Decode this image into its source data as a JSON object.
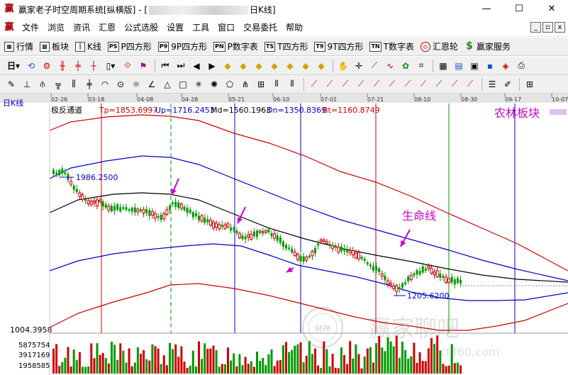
{
  "window": {
    "app_name": "赢家老子时空周期系统[纵横版]",
    "title_prefix": "赢家老子时空周期系统[纵横版] - [",
    "title_suffix": "日K线]",
    "minimize": "—",
    "maximize": "☐",
    "close": "✕"
  },
  "menu": {
    "logo": "赢",
    "items": [
      "文件",
      "浏览",
      "资讯",
      "汇恩",
      "公式选股",
      "设置",
      "工具",
      "窗口",
      "交易委托",
      "帮助"
    ],
    "mdi_buttons": [
      "_",
      "▫",
      "x"
    ]
  },
  "toolbar1": {
    "items": [
      {
        "icon": "▦",
        "label": "行情"
      },
      {
        "icon": "▩",
        "label": "板块"
      },
      {
        "icon": "┃",
        "label": "K线"
      },
      {
        "icon": "PS",
        "label": "P四方形"
      },
      {
        "icon": "P9",
        "label": "9P四方形"
      },
      {
        "icon": "PN",
        "label": "P数字表"
      },
      {
        "icon": "TS",
        "label": "T四方形"
      },
      {
        "icon": "T9",
        "label": "9T四方形"
      },
      {
        "icon": "TN",
        "label": "T数字表"
      },
      {
        "icon": "◎",
        "label": "汇恩轮"
      },
      {
        "icon": "$",
        "label": "赢家服务"
      }
    ]
  },
  "chart": {
    "period_label": "日K线",
    "indicator_name": "极反通道",
    "tp_label": "Tp=1853.6997",
    "up_label": "Up=1716.2453",
    "md_label": "Md=1560.1963",
    "dn_label": "Dn=1350.8369",
    "bt_label": "Bt=1160.8749",
    "sector_name": "农林板块",
    "annotation_text": "生命线",
    "high_label": "1986.2500",
    "low_label": "1205.6200",
    "price_axis_label": "1004.3958",
    "volume_labels": [
      "5875754",
      "3917169",
      "1958585"
    ],
    "date_ticks": [
      "02-26",
      "03-18",
      "04-08",
      "04-28",
      "05-21",
      "06-10",
      "07-01",
      "07-21",
      "08-10",
      "08-30",
      "09-17",
      "10-07"
    ],
    "watermark_text": "赢家聊吧",
    "watermark_url": "cf360.com",
    "watermark_seal": "财神",
    "colors": {
      "tp": "#cc0000",
      "up": "#0000cc",
      "md": "#000000",
      "dn": "#0000cc",
      "bt": "#cc0000",
      "candle_up": "#cc0000",
      "candle_down": "#009900",
      "annotation": "#cc00cc",
      "period_label": "#0000cc"
    }
  }
}
